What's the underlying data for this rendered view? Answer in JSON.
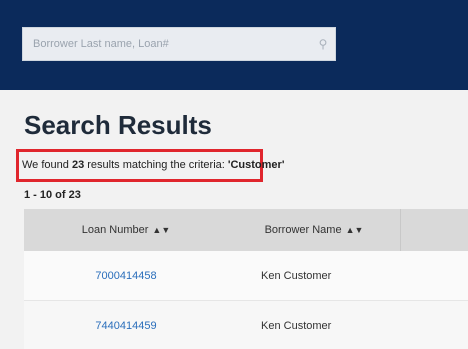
{
  "search": {
    "placeholder": "Borrower Last name, Loan#",
    "icon": "search-icon"
  },
  "page": {
    "title": "Search Results"
  },
  "results": {
    "found_prefix": "We found ",
    "count": "23",
    "found_middle": " results matching the criteria: ",
    "criteria": "'Customer'",
    "pager": "1 - 10 of 23"
  },
  "table": {
    "columns": [
      {
        "label": "Loan Number",
        "sort_icon": "sort-icon"
      },
      {
        "label": "Borrower Name",
        "sort_icon": "sort-icon"
      }
    ],
    "rows": [
      {
        "loan": "7000414458",
        "name": "Ken Customer"
      },
      {
        "loan": "7440414459",
        "name": "Ken Customer"
      }
    ]
  },
  "colors": {
    "header_bg": "#0b2a5b",
    "highlight_border": "#e0262d",
    "link": "#2a6ebb"
  }
}
